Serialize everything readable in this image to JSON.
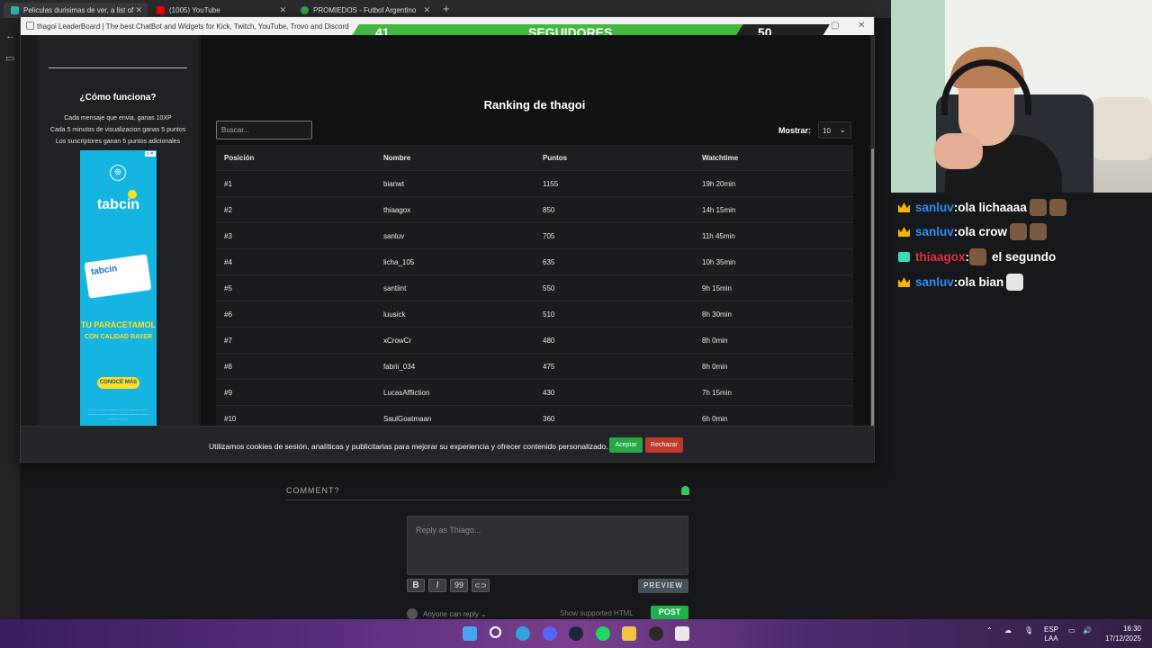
{
  "browser": {
    "tabs": [
      {
        "title": "Peliculas durisimas de ver, a list of",
        "close": "✕",
        "favicon_color": "#2db7a8"
      },
      {
        "title": "(1005) YouTube",
        "close": "✕",
        "favicon_color": "#ff0000"
      },
      {
        "title": "PROMIEDOS - Futbol Argentino",
        "close": "✕",
        "favicon_color": "#3ca545"
      }
    ],
    "new_tab": "+"
  },
  "popup": {
    "window_title": "thagoi LeaderBoard | The best ChatBot and Widgets for Kick, Twitch, YouTube, Trovo and Discord",
    "goal": {
      "current": "41",
      "label": "SEGUIDORES",
      "target": "50",
      "progress_fraction": 0.82
    },
    "sidebar": {
      "how_title": "¿Cómo funciona?",
      "rules": [
        "Cada mensaje que envia, ganas 10XP",
        "Cada 5 minutos de visualizacion ganas 5 puntos",
        "Los suscriptores ganan 5 puntos adicionales"
      ],
      "ad": {
        "brand": "tabcin",
        "slogan_line1": "TU PARACETAMOL",
        "slogan_line2": "CON CALIDAD BAYER",
        "cta": "CONOCÉ MÁS",
        "bayer": "⊕",
        "pack": "tabcin"
      }
    },
    "ranking": {
      "title": "Ranking de thagoi",
      "search_placeholder": "Buscar...",
      "show_label": "Mostrar:",
      "show_value": "10",
      "columns": [
        "Posición",
        "Nombre",
        "Puntos",
        "Watchtime"
      ],
      "rows": [
        [
          "#1",
          "bianwt",
          "1155",
          "19h 20min"
        ],
        [
          "#2",
          "thiaagox",
          "850",
          "14h 15min"
        ],
        [
          "#3",
          "sanluv",
          "705",
          "11h 45min"
        ],
        [
          "#4",
          "licha_105",
          "635",
          "10h 35min"
        ],
        [
          "#5",
          "santiint",
          "550",
          "9h 15min"
        ],
        [
          "#6",
          "luusick",
          "510",
          "8h 30min"
        ],
        [
          "#7",
          "xCrowCr",
          "480",
          "8h 0min"
        ],
        [
          "#8",
          "fabrii_034",
          "475",
          "8h 0min"
        ],
        [
          "#9",
          "LucasAffliction",
          "430",
          "7h 15min"
        ],
        [
          "#10",
          "SaulGoatmaan",
          "360",
          "6h 0min"
        ]
      ]
    },
    "cookie": {
      "text": "Utilizamos cookies de sesión, analíticas y publicitarias para mejorar su experiencia y ofrecer contenido personalizado.",
      "accept": "Aceptar",
      "reject": "Rechazar"
    }
  },
  "comments": {
    "title": "COMMENT?",
    "placeholder": "Reply as Thiago...",
    "bold": "B",
    "italic": "I",
    "quote": "99",
    "link": "⊂⊃",
    "preview": "PREVIEW",
    "audience": "Anyone can reply ⌄",
    "supported_html": "Show supported HTML",
    "post": "POST"
  },
  "stream_chat": [
    {
      "user": "sanluv",
      "sep": " : ",
      "text": "ola lichaaaa",
      "user_color": "#2f8cf0",
      "badge": "crown",
      "emotes": 2
    },
    {
      "user": "sanluv",
      "sep": " : ",
      "text": "ola crow",
      "user_color": "#2f8cf0",
      "badge": "crown",
      "emotes": 2
    },
    {
      "user": "thiaagox",
      "sep": " : ",
      "text": "el segundo",
      "user_color": "#e0303a",
      "badge": "gift",
      "emotes": 1
    },
    {
      "user": "sanluv",
      "sep": " : ",
      "text": "ola bian",
      "user_color": "#2f8cf0",
      "badge": "crown",
      "emotes": 1
    }
  ],
  "taskbar": {
    "lang1": "ESP",
    "lang2": "LAA",
    "time": "16:30",
    "date": "17/12/2025"
  }
}
